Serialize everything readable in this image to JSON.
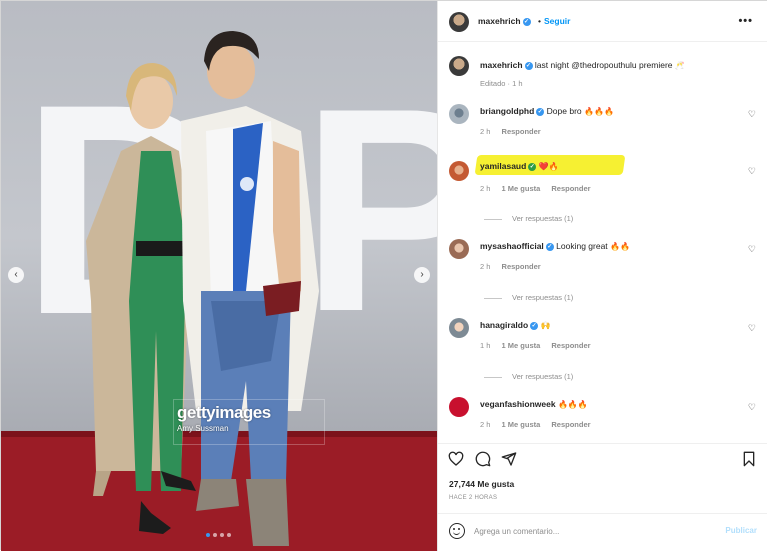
{
  "photo": {
    "watermark_brand": "gettyimages",
    "watermark_credit": "Amy Sussman",
    "backdrop_letters": [
      "D",
      "R",
      "O",
      "P"
    ],
    "dots_count": 4,
    "active_dot": 1,
    "prev_icon": "chevron-left-icon",
    "next_icon": "chevron-right-icon"
  },
  "header": {
    "username": "maxehrich",
    "separator": "•",
    "follow_label": "Seguir",
    "more_icon": "more-icon"
  },
  "caption": {
    "username": "maxehrich",
    "text": "last night @thedropouthulu premiere",
    "emoji": "🥂",
    "meta": "Editado · 1 h"
  },
  "comments": [
    {
      "username": "briangoldphd",
      "verified": true,
      "text": "Dope bro",
      "emoji": "🔥🔥🔥",
      "time": "2 h",
      "likes": "",
      "reply": "Responder",
      "replies": ""
    },
    {
      "username": "yamilasaud",
      "verified": true,
      "text": "",
      "emoji": "❤️🔥",
      "time": "2 h",
      "likes": "1 Me gusta",
      "reply": "Responder",
      "replies": "Ver respuestas (1)"
    },
    {
      "username": "mysashaofficial",
      "verified": true,
      "text": "Looking great",
      "emoji": "🔥🔥",
      "time": "2 h",
      "likes": "",
      "reply": "Responder",
      "replies": "Ver respuestas (1)"
    },
    {
      "username": "hanagiraldo",
      "verified": true,
      "text": "",
      "emoji": "🙌",
      "time": "1 h",
      "likes": "1 Me gusta",
      "reply": "Responder",
      "replies": "Ver respuestas (1)"
    },
    {
      "username": "veganfashionweek",
      "verified": false,
      "text": "",
      "emoji": "🔥🔥🔥",
      "time": "2 h",
      "likes": "1 Me gusta",
      "reply": "Responder",
      "replies": ""
    }
  ],
  "actions": {
    "likes_count": "27,744 Me gusta",
    "time_ago": "HACE 2 HORAS"
  },
  "add_comment": {
    "placeholder": "Agrega un comentario...",
    "post_label": "Publicar"
  },
  "colors": {
    "accent": "#0095f6",
    "verified": "#3897f0",
    "highlight": "#f6f032",
    "carpet": "#9b1c26"
  }
}
